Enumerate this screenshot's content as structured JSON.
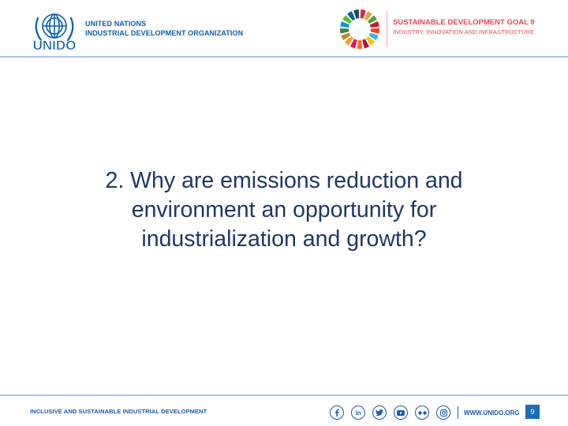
{
  "header": {
    "org_name_line1": "UNITED NATIONS",
    "org_name_line2": "INDUSTRIAL DEVELOPMENT ORGANIZATION",
    "logo_text": "UNIDO",
    "sdg_title": "SUSTAINABLE DEVELOPMENT",
    "sdg_goal": "GOAL 9",
    "sdg_subtitle": "INDUSTRY, INNOVATION AND INFRASTRUCTURE",
    "sdg_wheel_colors": [
      "#e5243b",
      "#dda63a",
      "#4c9f38",
      "#c5192d",
      "#ff3a21",
      "#26bde2",
      "#fcc30b",
      "#a21942",
      "#fd6925",
      "#dd1367",
      "#fd9d24",
      "#bf8b2e",
      "#3f7e44",
      "#0a97d9",
      "#56c02b",
      "#00689d",
      "#19486a"
    ]
  },
  "slide": {
    "title_line1": "2. Why are emissions reduction and",
    "title_line2": "environment an opportunity for",
    "title_line3": "industrialization and growth?"
  },
  "footer": {
    "tagline": "INCLUSIVE AND SUSTAINABLE INDUSTRIAL DEVELOPMENT",
    "social_icons": [
      "facebook-icon",
      "linkedin-icon",
      "twitter-icon",
      "youtube-icon",
      "flickr-icon",
      "instagram-icon"
    ],
    "linkedin_label": "in",
    "website": "WWW.UNIDO.ORG",
    "page_number": "9"
  },
  "colors": {
    "unido_blue": "#0b5ea8",
    "sdg_red": "#e8474f",
    "title_navy": "#1f3864",
    "rule_blue": "#a9c7e3",
    "page_badge": "#1e6bb8"
  }
}
